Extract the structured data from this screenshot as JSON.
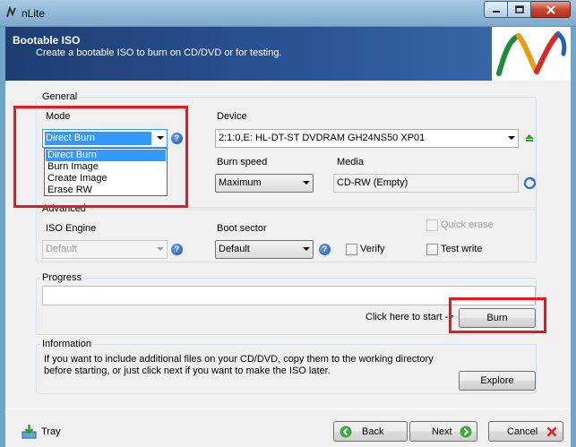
{
  "window": {
    "title": "nLite"
  },
  "banner": {
    "title": "Bootable ISO",
    "subtitle": "Create a bootable ISO to burn on CD/DVD or for testing."
  },
  "general": {
    "label": "General",
    "mode_label": "Mode",
    "mode_value": "Direct Burn",
    "mode_options": [
      "Direct Burn",
      "Burn Image",
      "Create Image",
      "Erase RW"
    ],
    "device_label": "Device",
    "device_value": "2:1:0,E: HL-DT-ST DVDRAM GH24NS50  XP01",
    "burn_speed_label": "Burn speed",
    "burn_speed_value": "Maximum",
    "media_label": "Media",
    "media_value": "CD-RW (Empty)"
  },
  "advanced": {
    "label": "Advanced",
    "iso_engine_label": "ISO Engine",
    "iso_engine_value": "Default",
    "boot_sector_label": "Boot sector",
    "boot_sector_value": "Default",
    "verify_label": "Verify",
    "quick_erase_label": "Quick erase",
    "test_write_label": "Test write"
  },
  "progress": {
    "label": "Progress",
    "click_here": "Click here to start ->",
    "burn_button": "Burn",
    "value": 0
  },
  "information": {
    "label": "Information",
    "line1": "If you want to include additional files on your CD/DVD, copy them to the working directory",
    "line2": "before starting, or just click next if you want to make the ISO later.",
    "explore_button": "Explore"
  },
  "footer": {
    "tray": "Tray",
    "back": "Back",
    "next": "Next",
    "cancel": "Cancel"
  },
  "colors": {
    "highlight_box": "#e8161f",
    "selection": "#3399ff",
    "banner": "#2b5598"
  }
}
